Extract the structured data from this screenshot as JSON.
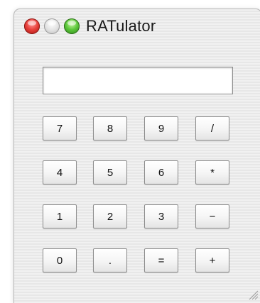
{
  "window": {
    "title": "RATulator"
  },
  "display": {
    "value": ""
  },
  "keys": {
    "k7": "7",
    "k8": "8",
    "k9": "9",
    "divide": "/",
    "k4": "4",
    "k5": "5",
    "k6": "6",
    "multiply": "*",
    "k1": "1",
    "k2": "2",
    "k3": "3",
    "subtract": "−",
    "k0": "0",
    "decimal": ".",
    "equals": "=",
    "add": "+"
  },
  "icons": {
    "close": "close-icon",
    "minimize": "minimize-icon",
    "zoom": "zoom-icon",
    "resize": "resize-grip-icon"
  },
  "colors": {
    "close": "#e8403b",
    "minimize": "#d0d0d0",
    "zoom": "#5cc83a"
  }
}
